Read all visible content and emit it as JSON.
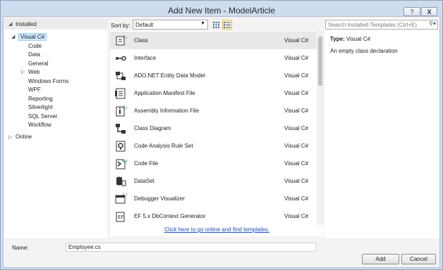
{
  "window": {
    "title": "Add New Item - ModelArticle",
    "help_label": "?",
    "close_label": "X"
  },
  "tree": {
    "installed": "Installed",
    "selected": "Visual C#",
    "children": [
      "Code",
      "Data",
      "General",
      "Web",
      "Windows Forms",
      "WPF",
      "Reporting",
      "Silverlight",
      "SQL Server",
      "Workflow"
    ],
    "online": "Online"
  },
  "toolbar": {
    "sort_label": "Sort by:",
    "sort_value": "Default"
  },
  "search": {
    "placeholder": "Search Installed Templates (Ctrl+E)"
  },
  "templates": [
    {
      "name": "Class",
      "lang": "Visual C#",
      "icon": "class-icon"
    },
    {
      "name": "Interface",
      "lang": "Visual C#",
      "icon": "interface-icon"
    },
    {
      "name": "ADO.NET Entity Data Model",
      "lang": "Visual C#",
      "icon": "entity-model-icon"
    },
    {
      "name": "Application Manifest File",
      "lang": "Visual C#",
      "icon": "manifest-icon"
    },
    {
      "name": "Assembly Information File",
      "lang": "Visual C#",
      "icon": "assembly-info-icon"
    },
    {
      "name": "Class Diagram",
      "lang": "Visual C#",
      "icon": "class-diagram-icon"
    },
    {
      "name": "Code Analysis Rule Set",
      "lang": "Visual C#",
      "icon": "rule-set-icon"
    },
    {
      "name": "Code File",
      "lang": "Visual C#",
      "icon": "code-file-icon"
    },
    {
      "name": "DataSet",
      "lang": "Visual C#",
      "icon": "dataset-icon"
    },
    {
      "name": "Debugger Visualizer",
      "lang": "Visual C#",
      "icon": "debugger-visualizer-icon"
    },
    {
      "name": "EF 5.x DbContext Generator",
      "lang": "Visual C#",
      "icon": "ef-generator-icon"
    }
  ],
  "find_link": "Click here to go online and find templates.",
  "details": {
    "type_label": "Type:",
    "type_value": "Visual C#",
    "description": "An empty class declaration"
  },
  "name_field": {
    "label": "Name:",
    "value": "Employee.cs"
  },
  "buttons": {
    "add": "Add",
    "cancel": "Cancel"
  },
  "colors": {
    "accent": "#1a4fbf",
    "selection": "#cde8ff"
  }
}
